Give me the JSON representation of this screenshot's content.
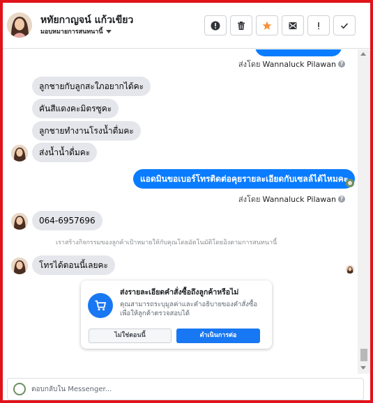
{
  "header": {
    "contact_name": "หทัยกาญจน์ แก้วเขียว",
    "assign_label": "มอบหมายการสนทนานี้",
    "toolbar": [
      {
        "name": "report-spam-button",
        "icon": "alert-circle-icon"
      },
      {
        "name": "delete-button",
        "icon": "trash-icon"
      },
      {
        "name": "star-button",
        "icon": "star-icon"
      },
      {
        "name": "mark-unread-button",
        "icon": "envelope-icon"
      },
      {
        "name": "important-button",
        "icon": "exclamation-icon"
      },
      {
        "name": "mark-done-button",
        "icon": "check-icon"
      }
    ]
  },
  "chat": {
    "sent_by_1": {
      "prefix": "ส่งโดย",
      "name": "Wannaluck Pilawan"
    },
    "incoming_group_1": [
      "ลูกชายกับลูกสะใภอยากได้คะ",
      "คันสีแดงคะมิตรซูคะ",
      "ลูกชายทำงานโรงน้ำดื่มคะ",
      "ส่งน้ำน้ำดื่มคะ"
    ],
    "outgoing_1": "แอดมินขอเบอร์โทรติดต่อคุยรายละเอียดกับเซลล์ได้ไหมคะ",
    "sent_by_2": {
      "prefix": "ส่งโดย",
      "name": "Wannaluck Pilawan"
    },
    "incoming_phone": "064-6957696",
    "system_note": "เราสร้างกิจกรรมของลูกค้าเป้าหมายให้กับคุณโดยอัตโนมัติโดยอิงตามการสนทนานี้",
    "incoming_last": "โทรได้ตอนนี้เลยคะ"
  },
  "card": {
    "title": "ส่งรายละเอียดคำสั่งซื้อถึงลูกค้าหรือไม่",
    "description": "คุณสามารถระบุมูลค่าและคำอธิบายของคำสั่งซื้อเพื่อให้ลูกค้าตรวจสอบได้",
    "button_no": "ไม่ใช่ตอนนี้",
    "button_go": "ดำเนินการต่อ",
    "icon": "cart-icon"
  },
  "composer": {
    "placeholder": "ตอบกลับใน Messenger..."
  },
  "colors": {
    "accent": "#0a7cff",
    "incoming_bubble": "#e4e6eb",
    "frame_border": "#e0131b"
  }
}
